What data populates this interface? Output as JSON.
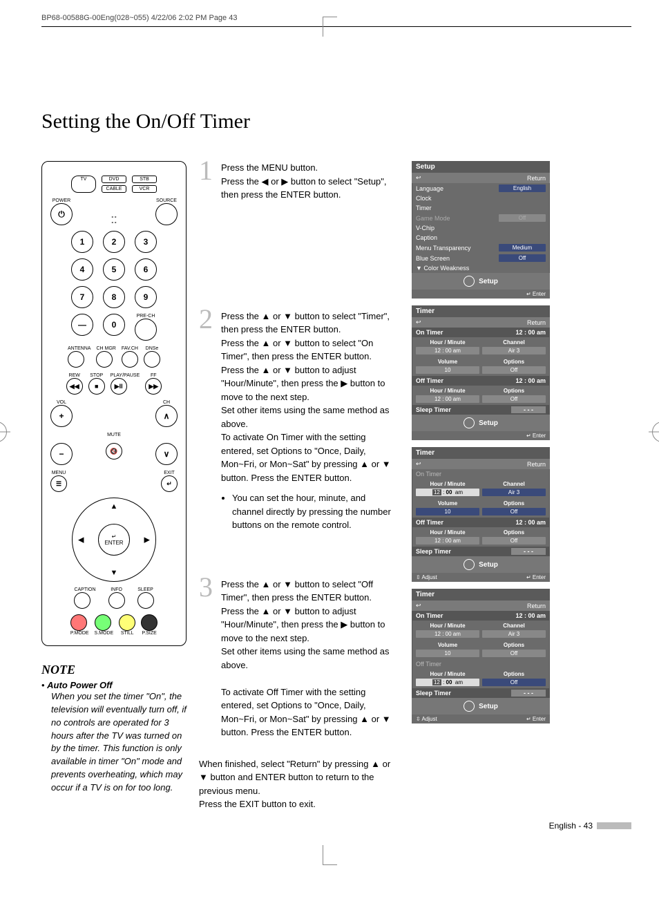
{
  "header": "BP68-00588G-00Eng(028~055)  4/22/06  2:02 PM  Page 43",
  "title": "Setting the On/Off Timer",
  "note": {
    "head": "NOTE",
    "sub": "Auto Power Off",
    "body": "When you set the timer \"On\", the television will eventually turn off, if no controls are operated for 3 hours after the TV was turned on by the timer. This function is only available in timer \"On\" mode and prevents overheating, which may occur if a TV is on for too long."
  },
  "steps": {
    "s1": {
      "num": "1",
      "text": "Press the MENU button.\nPress the ◀ or ▶ button to select \"Setup\", then press  the ENTER button."
    },
    "s2": {
      "num": "2",
      "text": "Press the ▲ or ▼ button to select \"Timer\", then press the ENTER button.\nPress the ▲ or ▼ button to select \"On Timer\", then press the ENTER button.\nPress the ▲ or ▼ button to adjust \"Hour/Minute\", then press the ▶ button to move to the next step.\nSet other items using the same method as above.\nTo activate On Timer with the setting entered, set Options to \"Once, Daily, Mon~Fri, or Mon~Sat\" by pressing ▲ or ▼ button. Press the ENTER button.",
      "bullet": "You can set the hour, minute, and channel directly by pressing the number buttons on the remote control."
    },
    "s3": {
      "num": "3",
      "text": "Press the ▲ or ▼ button to select \"Off Timer\", then press the ENTER button.\nPress the ▲ or ▼ button to adjust \"Hour/Minute\", then press the ▶ button to move to the next step.\nSet other items using the same method as above.\n\nTo activate Off Timer with the setting entered, set Options to \"Once, Daily, Mon~Fri, or Mon~Sat\" by pressing ▲ or ▼ button. Press the ENTER button."
    }
  },
  "finish": "When finished, select \"Return\" by pressing ▲ or ▼ button and ENTER button to return to the previous menu.\nPress the EXIT button to exit.",
  "pagenum": "English - 43",
  "osd": {
    "setup": {
      "title": "Setup",
      "return": "Return",
      "items": {
        "lang": "Language",
        "lang_v": "English",
        "clock": "Clock",
        "timer": "Timer",
        "game": "Game Mode",
        "game_v": "Off",
        "vchip": "V-Chip",
        "caption": "Caption",
        "trans": "Menu Transparency",
        "trans_v": "Medium",
        "blue": "Blue Screen",
        "blue_v": "Off",
        "color": "▼ Color Weakness"
      },
      "foot": "Setup",
      "enter": "Enter"
    },
    "timer_a": {
      "title": "Timer",
      "return": "Return",
      "ontimer": "On Timer",
      "ontimer_v": "12 : 00 am",
      "hm": "Hour / Minute",
      "ch": "Channel",
      "hm_v": "12 : 00   am",
      "ch_v": "Air        3",
      "vol": "Volume",
      "opt": "Options",
      "vol_v": "10",
      "opt_v": "Off",
      "offtimer": "Off Timer",
      "offtimer_v": "12 : 00 am",
      "hm2": "Hour / Minute",
      "opt2": "Options",
      "hm2_v": "12 : 00   am",
      "opt2_v": "Off",
      "sleep": "Sleep Timer",
      "sleep_v": "- - -",
      "foot": "Setup",
      "enter": "Enter"
    },
    "timer_b": {
      "title": "Timer",
      "return": "Return",
      "ontimer": "On Timer",
      "hm": "Hour / Minute",
      "ch": "Channel",
      "hm_v": "12 : 00   am",
      "ch_v": "Air        3",
      "vol": "Volume",
      "opt": "Options",
      "vol_v": "10",
      "opt_v": "Off",
      "offtimer": "Off Timer",
      "offtimer_v": "12 : 00 am",
      "hm2": "Hour / Minute",
      "opt2": "Options",
      "hm2_v": "12 : 00   am",
      "opt2_v": "Off",
      "sleep": "Sleep Timer",
      "sleep_v": "- - -",
      "foot": "Setup",
      "adjust": "Adjust",
      "enter": "Enter"
    },
    "timer_c": {
      "title": "Timer",
      "return": "Return",
      "ontimer": "On Timer",
      "ontimer_v": "12 : 00 am",
      "hm": "Hour / Minute",
      "ch": "Channel",
      "hm_v": "12 : 00   am",
      "ch_v": "Air        3",
      "vol": "Volume",
      "opt": "Options",
      "vol_v": "10",
      "opt_v": "Off",
      "offtimer": "Off Timer",
      "hm2": "Hour / Minute",
      "opt2": "Options",
      "hm2_v": "12 : 00   am",
      "opt2_v": "Off",
      "sleep": "Sleep Timer",
      "sleep_v": "- - -",
      "foot": "Setup",
      "adjust": "Adjust",
      "enter": "Enter"
    }
  },
  "remote": {
    "tv": "TV",
    "dvd": "DVD",
    "stb": "STB",
    "cable": "CABLE",
    "vcr": "VCR",
    "power": "POWER",
    "source": "SOURCE",
    "n1": "1",
    "n2": "2",
    "n3": "3",
    "n4": "4",
    "n5": "5",
    "n6": "6",
    "n7": "7",
    "n8": "8",
    "n9": "9",
    "n0": "0",
    "dash": "—",
    "prech": "PRE-CH",
    "ant": "ANTENNA",
    "chmgr": "CH MGR",
    "favch": "FAV.CH",
    "dnse": "DNSe",
    "rew": "REW",
    "stop": "STOP",
    "play": "PLAY/PAUSE",
    "ff": "FF",
    "vol": "VOL",
    "ch": "CH",
    "mute": "MUTE",
    "menu": "MENU",
    "exit": "EXIT",
    "enter": "ENTER",
    "caption": "CAPTION",
    "info": "INFO",
    "sleep": "SLEEP",
    "pmode": "P.MODE",
    "smode": "S.MODE",
    "still": "STILL",
    "psize": "P.SIZE"
  }
}
